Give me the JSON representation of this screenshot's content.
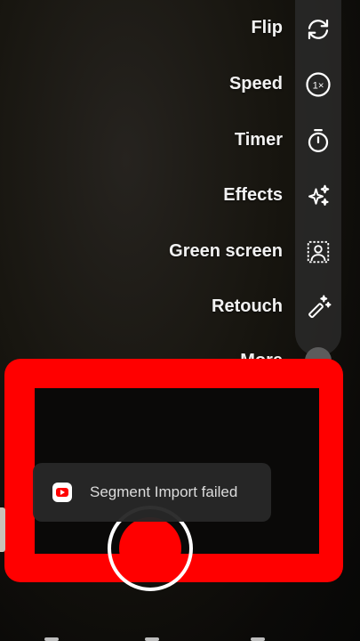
{
  "tools": [
    {
      "label": "Flip",
      "icon": "flip-icon"
    },
    {
      "label": "Speed",
      "icon": "speed-icon",
      "badge": "1×"
    },
    {
      "label": "Timer",
      "icon": "timer-icon"
    },
    {
      "label": "Effects",
      "icon": "effects-icon"
    },
    {
      "label": "Green screen",
      "icon": "green-screen-icon"
    },
    {
      "label": "Retouch",
      "icon": "retouch-icon"
    }
  ],
  "more": {
    "label": "More"
  },
  "toast": {
    "message": "Segment Import failed",
    "icon": "youtube-icon"
  },
  "colors": {
    "accent": "#ff0000",
    "toast_bg": "#282828"
  }
}
